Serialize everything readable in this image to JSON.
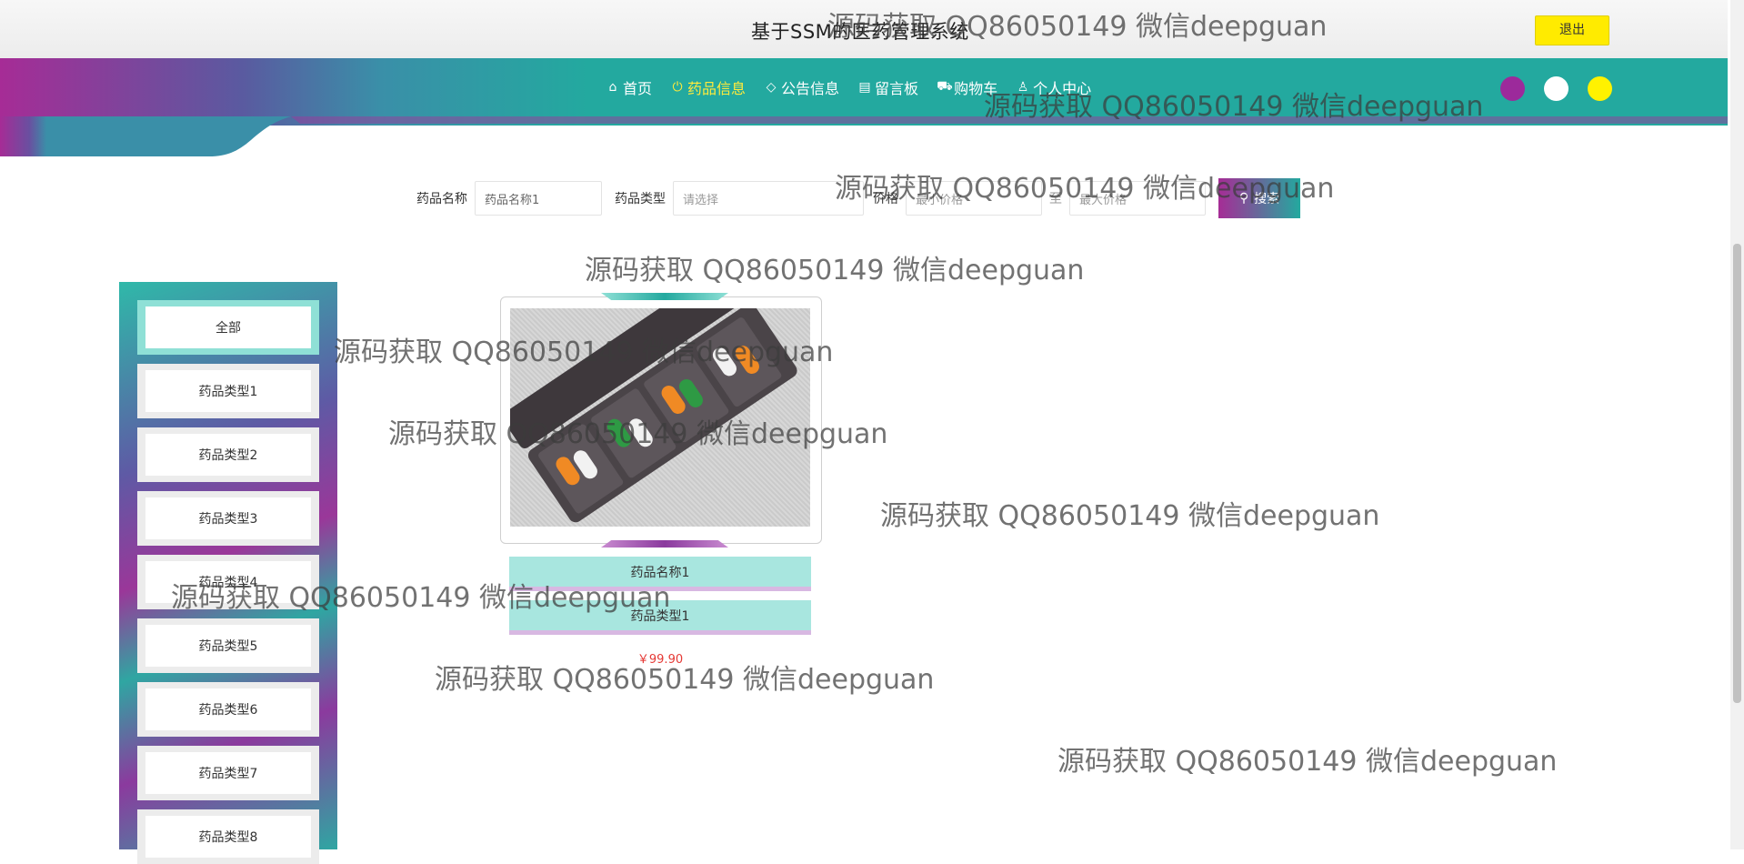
{
  "header": {
    "site_title": "基于SSM的医药管理系统",
    "logout_label": "退出"
  },
  "nav": {
    "items": [
      {
        "label": "首页",
        "icon": "home-icon"
      },
      {
        "label": "药品信息",
        "icon": "power-icon",
        "active": true
      },
      {
        "label": "公告信息",
        "icon": "tag-icon"
      },
      {
        "label": "留言板",
        "icon": "clipboard-icon"
      },
      {
        "label": "购物车",
        "icon": "cart-icon"
      },
      {
        "label": "个人中心",
        "icon": "user-icon"
      }
    ],
    "theme_colors": [
      "#9c2a9b",
      "#ffffff",
      "#fff200"
    ]
  },
  "search": {
    "name_label": "药品名称",
    "name_value": "药品名称1",
    "type_label": "药品类型",
    "type_placeholder": "请选择",
    "price_label": "价格",
    "min_placeholder": "最小价格",
    "to_label": "至",
    "max_placeholder": "最大价格",
    "button_label": "搜索",
    "button_icon": "search-icon"
  },
  "sidebar": {
    "items": [
      {
        "label": "全部",
        "active": true
      },
      {
        "label": "药品类型1"
      },
      {
        "label": "药品类型2"
      },
      {
        "label": "药品类型3"
      },
      {
        "label": "药品类型4"
      },
      {
        "label": "药品类型5"
      },
      {
        "label": "药品类型6"
      },
      {
        "label": "药品类型7"
      },
      {
        "label": "药品类型8"
      }
    ]
  },
  "product": {
    "name": "药品名称1",
    "type": "药品类型1",
    "price": "￥99.90"
  },
  "watermark": "源码获取 QQ86050149 微信deepguan"
}
